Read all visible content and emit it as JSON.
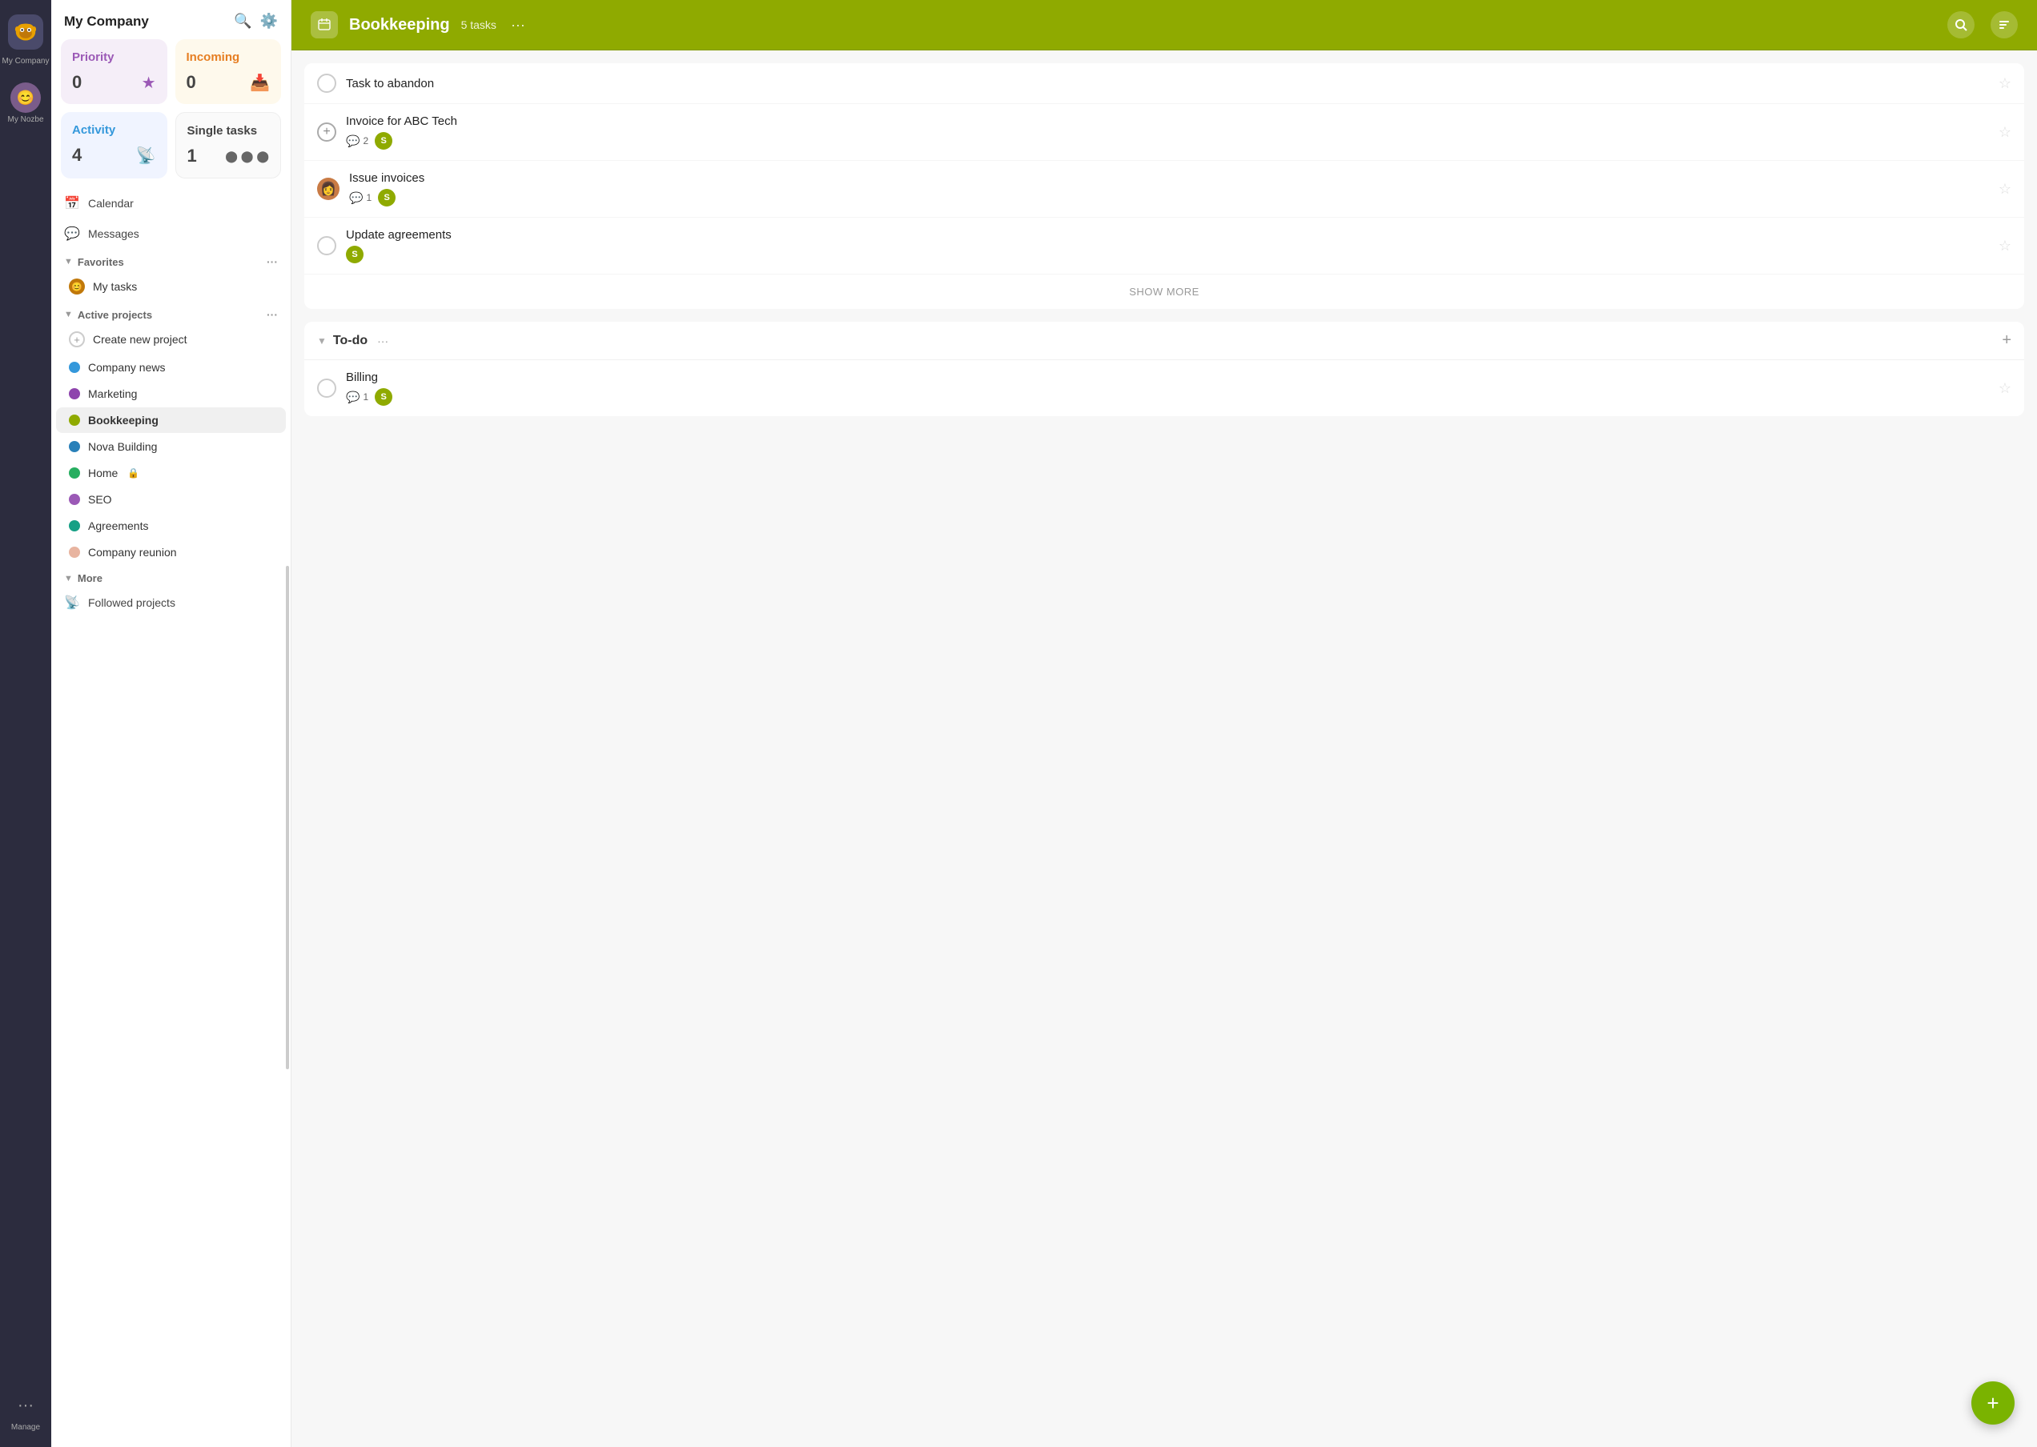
{
  "app": {
    "name": "My Company",
    "logo_letter": "🦊"
  },
  "icon_rail": {
    "my_nozbe_label": "My Nozbe",
    "manage_label": "Manage"
  },
  "sidebar": {
    "title": "My Company",
    "search_title": "Search",
    "settings_title": "Settings",
    "quick_cards": [
      {
        "id": "priority",
        "title": "Priority",
        "count": "0",
        "icon": "★",
        "type": "priority"
      },
      {
        "id": "incoming",
        "title": "Incoming",
        "count": "0",
        "icon": "📥",
        "type": "incoming"
      },
      {
        "id": "activity",
        "title": "Activity",
        "count": "4",
        "icon": "📡",
        "type": "activity"
      },
      {
        "id": "single",
        "title": "Single tasks",
        "count": "1",
        "icon": "⬤⬤",
        "type": "single"
      }
    ],
    "nav_items": [
      {
        "id": "calendar",
        "label": "Calendar",
        "icon": "📅"
      },
      {
        "id": "messages",
        "label": "Messages",
        "icon": "💬"
      }
    ],
    "favorites": {
      "label": "Favorites",
      "items": [
        {
          "id": "my-tasks",
          "label": "My tasks",
          "avatar": true
        }
      ]
    },
    "active_projects": {
      "label": "Active projects",
      "items": [
        {
          "id": "create-new",
          "label": "Create new project",
          "type": "plus"
        },
        {
          "id": "company-news",
          "label": "Company news",
          "color": "#3498db",
          "type": "dot"
        },
        {
          "id": "marketing",
          "label": "Marketing",
          "color": "#8e44ad",
          "type": "dot"
        },
        {
          "id": "bookkeeping",
          "label": "Bookkeeping",
          "color": "#8faa00",
          "type": "dot",
          "active": true
        },
        {
          "id": "nova-building",
          "label": "Nova Building",
          "color": "#2980b9",
          "type": "dot"
        },
        {
          "id": "home",
          "label": "Home",
          "color": "#27ae60",
          "type": "dot",
          "locked": true
        },
        {
          "id": "seo",
          "label": "SEO",
          "color": "#9b59b6",
          "type": "dot"
        },
        {
          "id": "agreements",
          "label": "Agreements",
          "color": "#16a085",
          "type": "dot"
        },
        {
          "id": "company-reunion",
          "label": "Company reunion",
          "color": "#e8b4a0",
          "type": "dot"
        }
      ]
    },
    "more": {
      "label": "More",
      "items": [
        {
          "id": "followed-projects",
          "label": "Followed projects",
          "icon": "📡"
        }
      ]
    }
  },
  "main": {
    "project_title": "Bookkeeping",
    "task_count": "5 tasks",
    "more_icon": "···",
    "sections": [
      {
        "id": "default",
        "title": null,
        "tasks": [
          {
            "id": "task-abandon",
            "title": "Task to abandon",
            "comments": null,
            "assignee": null,
            "has_s_badge": false
          },
          {
            "id": "task-invoice-abc",
            "title": "Invoice for ABC Tech",
            "comments": "2",
            "has_s_badge": true
          },
          {
            "id": "task-issue-invoices",
            "title": "Issue invoices",
            "comments": "1",
            "has_s_badge": true,
            "has_avatar": true
          },
          {
            "id": "task-update-agreements",
            "title": "Update agreements",
            "comments": null,
            "has_s_badge": true
          }
        ],
        "show_more": "SHOW MORE"
      },
      {
        "id": "todo",
        "title": "To-do",
        "tasks": [
          {
            "id": "task-billing",
            "title": "Billing",
            "comments": "1",
            "has_s_badge": true
          }
        ]
      }
    ]
  }
}
